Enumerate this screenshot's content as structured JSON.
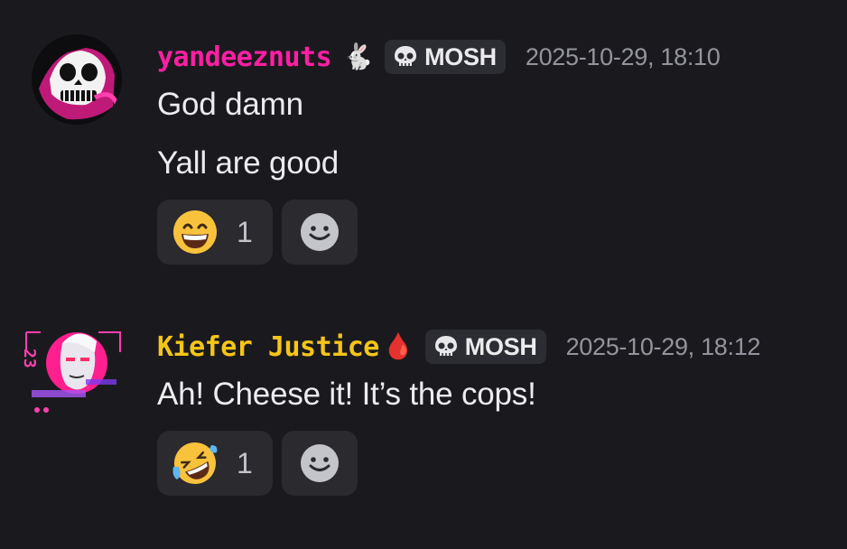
{
  "messages": [
    {
      "username": "yandeeznuts",
      "username_color": "#ff1fa4",
      "user_emoji": "🐇",
      "tag": {
        "icon": "skull-icon",
        "label": "MOSH"
      },
      "timestamp": "2025-10-29, 18:10",
      "lines": [
        "God damn",
        "Yall are good"
      ],
      "reaction": {
        "emoji": "grinning-face-icon",
        "count": "1"
      },
      "add_reaction_icon": "smiley-add-icon"
    },
    {
      "username": "Kiefer Justice",
      "username_color": "#f5c518",
      "user_emoji": "🩸",
      "tag": {
        "icon": "skull-icon",
        "label": "MOSH"
      },
      "timestamp": "2025-10-29, 18:12",
      "lines": [
        "Ah! Cheese it! It’s the cops!"
      ],
      "reaction": {
        "emoji": "rofl-face-icon",
        "count": "1"
      },
      "add_reaction_icon": "smiley-add-icon"
    }
  ],
  "colors": {
    "background": "#1a1a1e",
    "tag_bg": "#2c2d32",
    "reaction_bg": "#2a2a2f",
    "timestamp": "#94959c"
  }
}
